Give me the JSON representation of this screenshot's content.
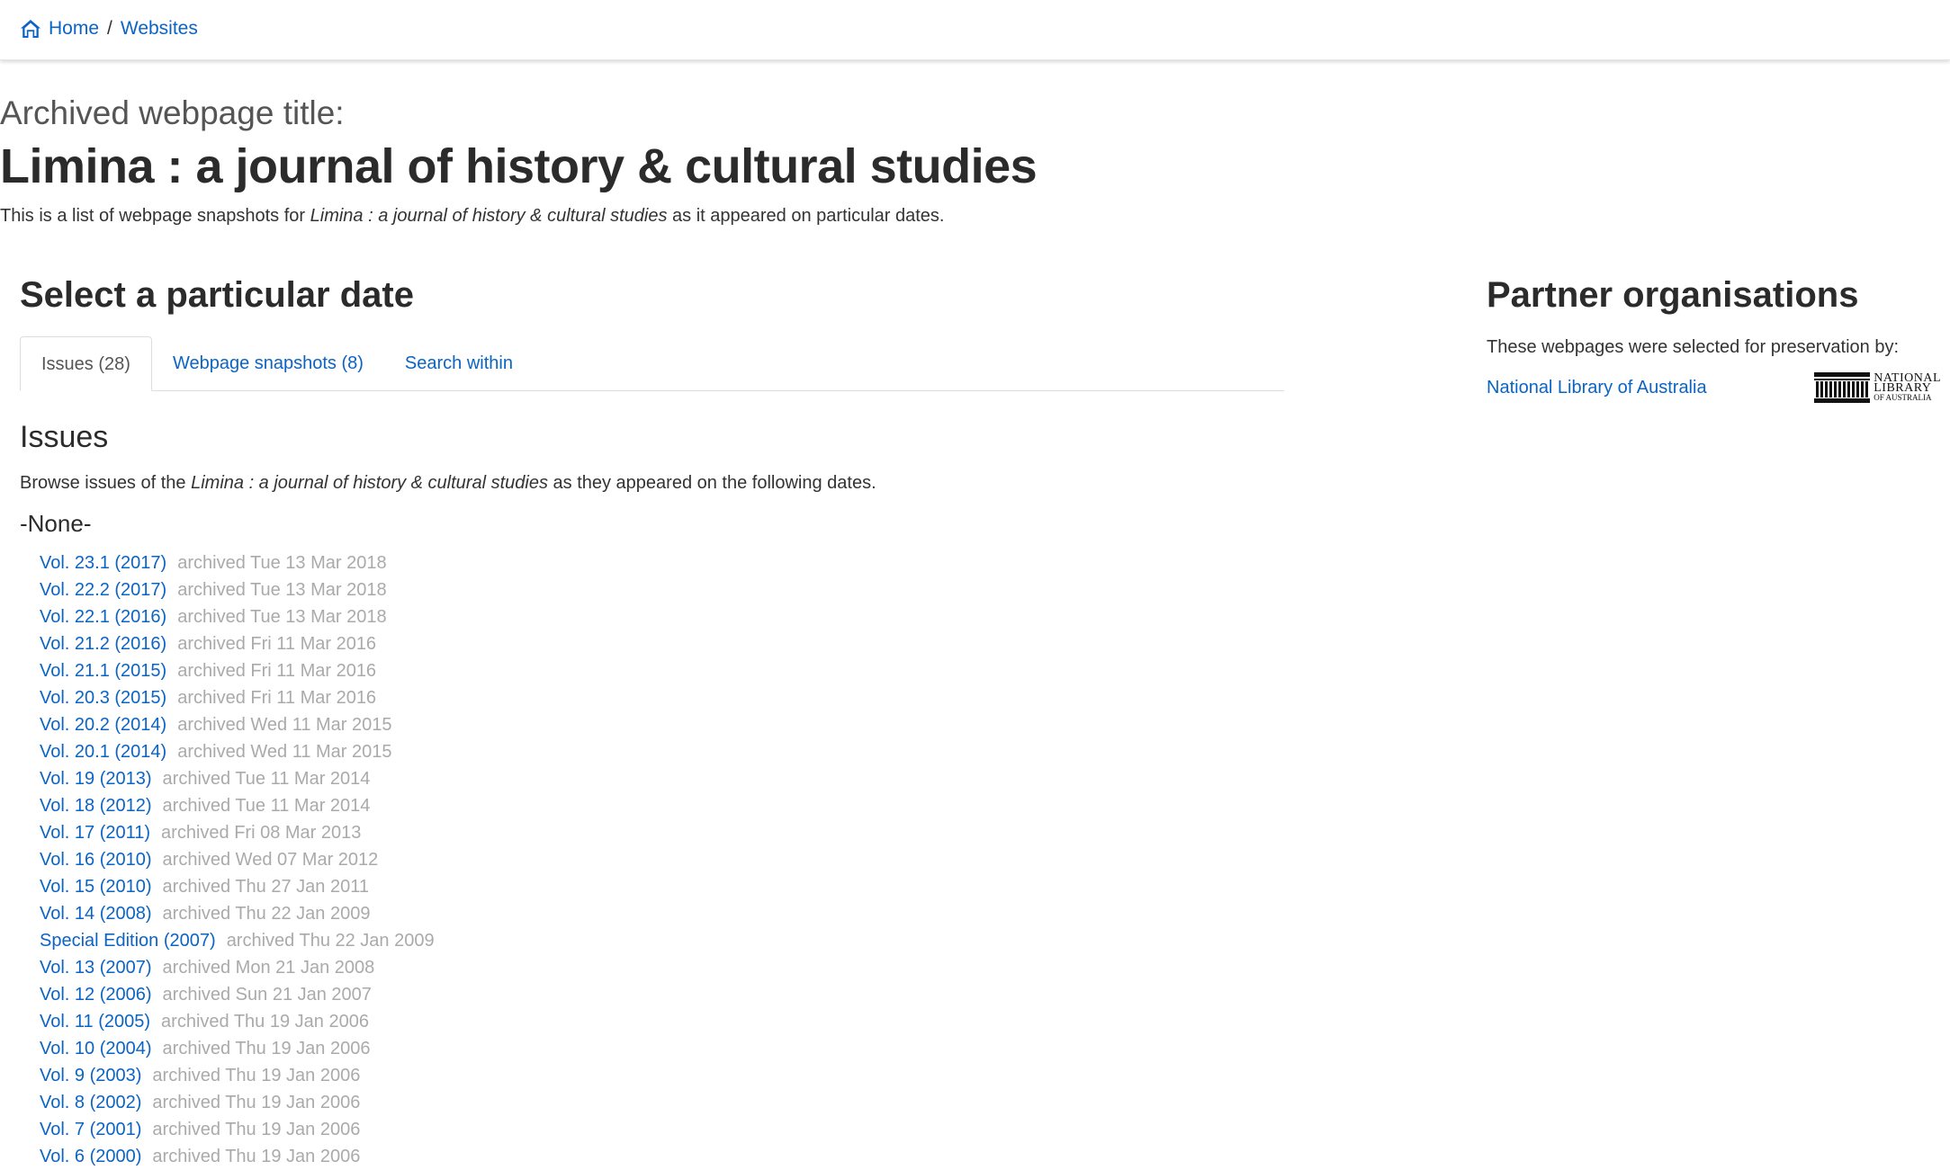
{
  "breadcrumb": {
    "home": "Home",
    "separator": "/",
    "websites": "Websites"
  },
  "header": {
    "archived_label": "Archived webpage title:",
    "title": "Limina : a journal of history & cultural studies",
    "intro_prefix": "This is a list of webpage snapshots for ",
    "intro_title": "Limina : a journal of history & cultural studies",
    "intro_suffix": " as it appeared on particular dates."
  },
  "main": {
    "section_title": "Select a particular date",
    "tabs": [
      {
        "label": "Issues (28)",
        "active": true
      },
      {
        "label": "Webpage snapshots (8)",
        "active": false
      },
      {
        "label": "Search within",
        "active": false
      }
    ],
    "issues_title": "Issues",
    "issues_desc_prefix": "Browse issues of the ",
    "issues_desc_title": "Limina : a journal of history & cultural studies",
    "issues_desc_suffix": " as they appeared on the following dates.",
    "group_label": "-None-",
    "issues": [
      {
        "name": "Vol. 23.1 (2017)",
        "date": "archived Tue 13 Mar 2018"
      },
      {
        "name": "Vol. 22.2 (2017)",
        "date": "archived Tue 13 Mar 2018"
      },
      {
        "name": "Vol. 22.1 (2016)",
        "date": "archived Tue 13 Mar 2018"
      },
      {
        "name": "Vol. 21.2 (2016)",
        "date": "archived Fri 11 Mar 2016"
      },
      {
        "name": "Vol. 21.1 (2015)",
        "date": "archived Fri 11 Mar 2016"
      },
      {
        "name": "Vol. 20.3 (2015)",
        "date": "archived Fri 11 Mar 2016"
      },
      {
        "name": "Vol. 20.2 (2014)",
        "date": "archived Wed 11 Mar 2015"
      },
      {
        "name": "Vol. 20.1 (2014)",
        "date": "archived Wed 11 Mar 2015"
      },
      {
        "name": "Vol. 19 (2013)",
        "date": "archived Tue 11 Mar 2014"
      },
      {
        "name": "Vol. 18 (2012)",
        "date": "archived Tue 11 Mar 2014"
      },
      {
        "name": "Vol. 17 (2011)",
        "date": "archived Fri 08 Mar 2013"
      },
      {
        "name": "Vol. 16 (2010)",
        "date": "archived Wed 07 Mar 2012"
      },
      {
        "name": "Vol. 15 (2010)",
        "date": "archived Thu 27 Jan 2011"
      },
      {
        "name": "Vol. 14 (2008)",
        "date": "archived Thu 22 Jan 2009"
      },
      {
        "name": "Special Edition (2007)",
        "date": "archived Thu 22 Jan 2009"
      },
      {
        "name": "Vol. 13 (2007)",
        "date": "archived Mon 21 Jan 2008"
      },
      {
        "name": "Vol. 12 (2006)",
        "date": "archived Sun 21 Jan 2007"
      },
      {
        "name": "Vol. 11 (2005)",
        "date": "archived Thu 19 Jan 2006"
      },
      {
        "name": "Vol. 10 (2004)",
        "date": "archived Thu 19 Jan 2006"
      },
      {
        "name": "Vol. 9 (2003)",
        "date": "archived Thu 19 Jan 2006"
      },
      {
        "name": "Vol. 8 (2002)",
        "date": "archived Thu 19 Jan 2006"
      },
      {
        "name": "Vol. 7 (2001)",
        "date": "archived Thu 19 Jan 2006"
      },
      {
        "name": "Vol. 6 (2000)",
        "date": "archived Thu 19 Jan 2006"
      }
    ]
  },
  "side": {
    "title": "Partner organisations",
    "desc": "These webpages were selected for preservation by:",
    "partner_name": "National Library of Australia",
    "logo_text": {
      "line1": "NATIONAL",
      "line2": "LIBRARY",
      "line3": "OF AUSTRALIA"
    }
  },
  "colors": {
    "link": "#0b64c4",
    "muted_date": "#aaaaaa",
    "heading": "#2b2b2b"
  },
  "icons": {
    "home": "home-icon",
    "logo": "nla-building-logo"
  }
}
